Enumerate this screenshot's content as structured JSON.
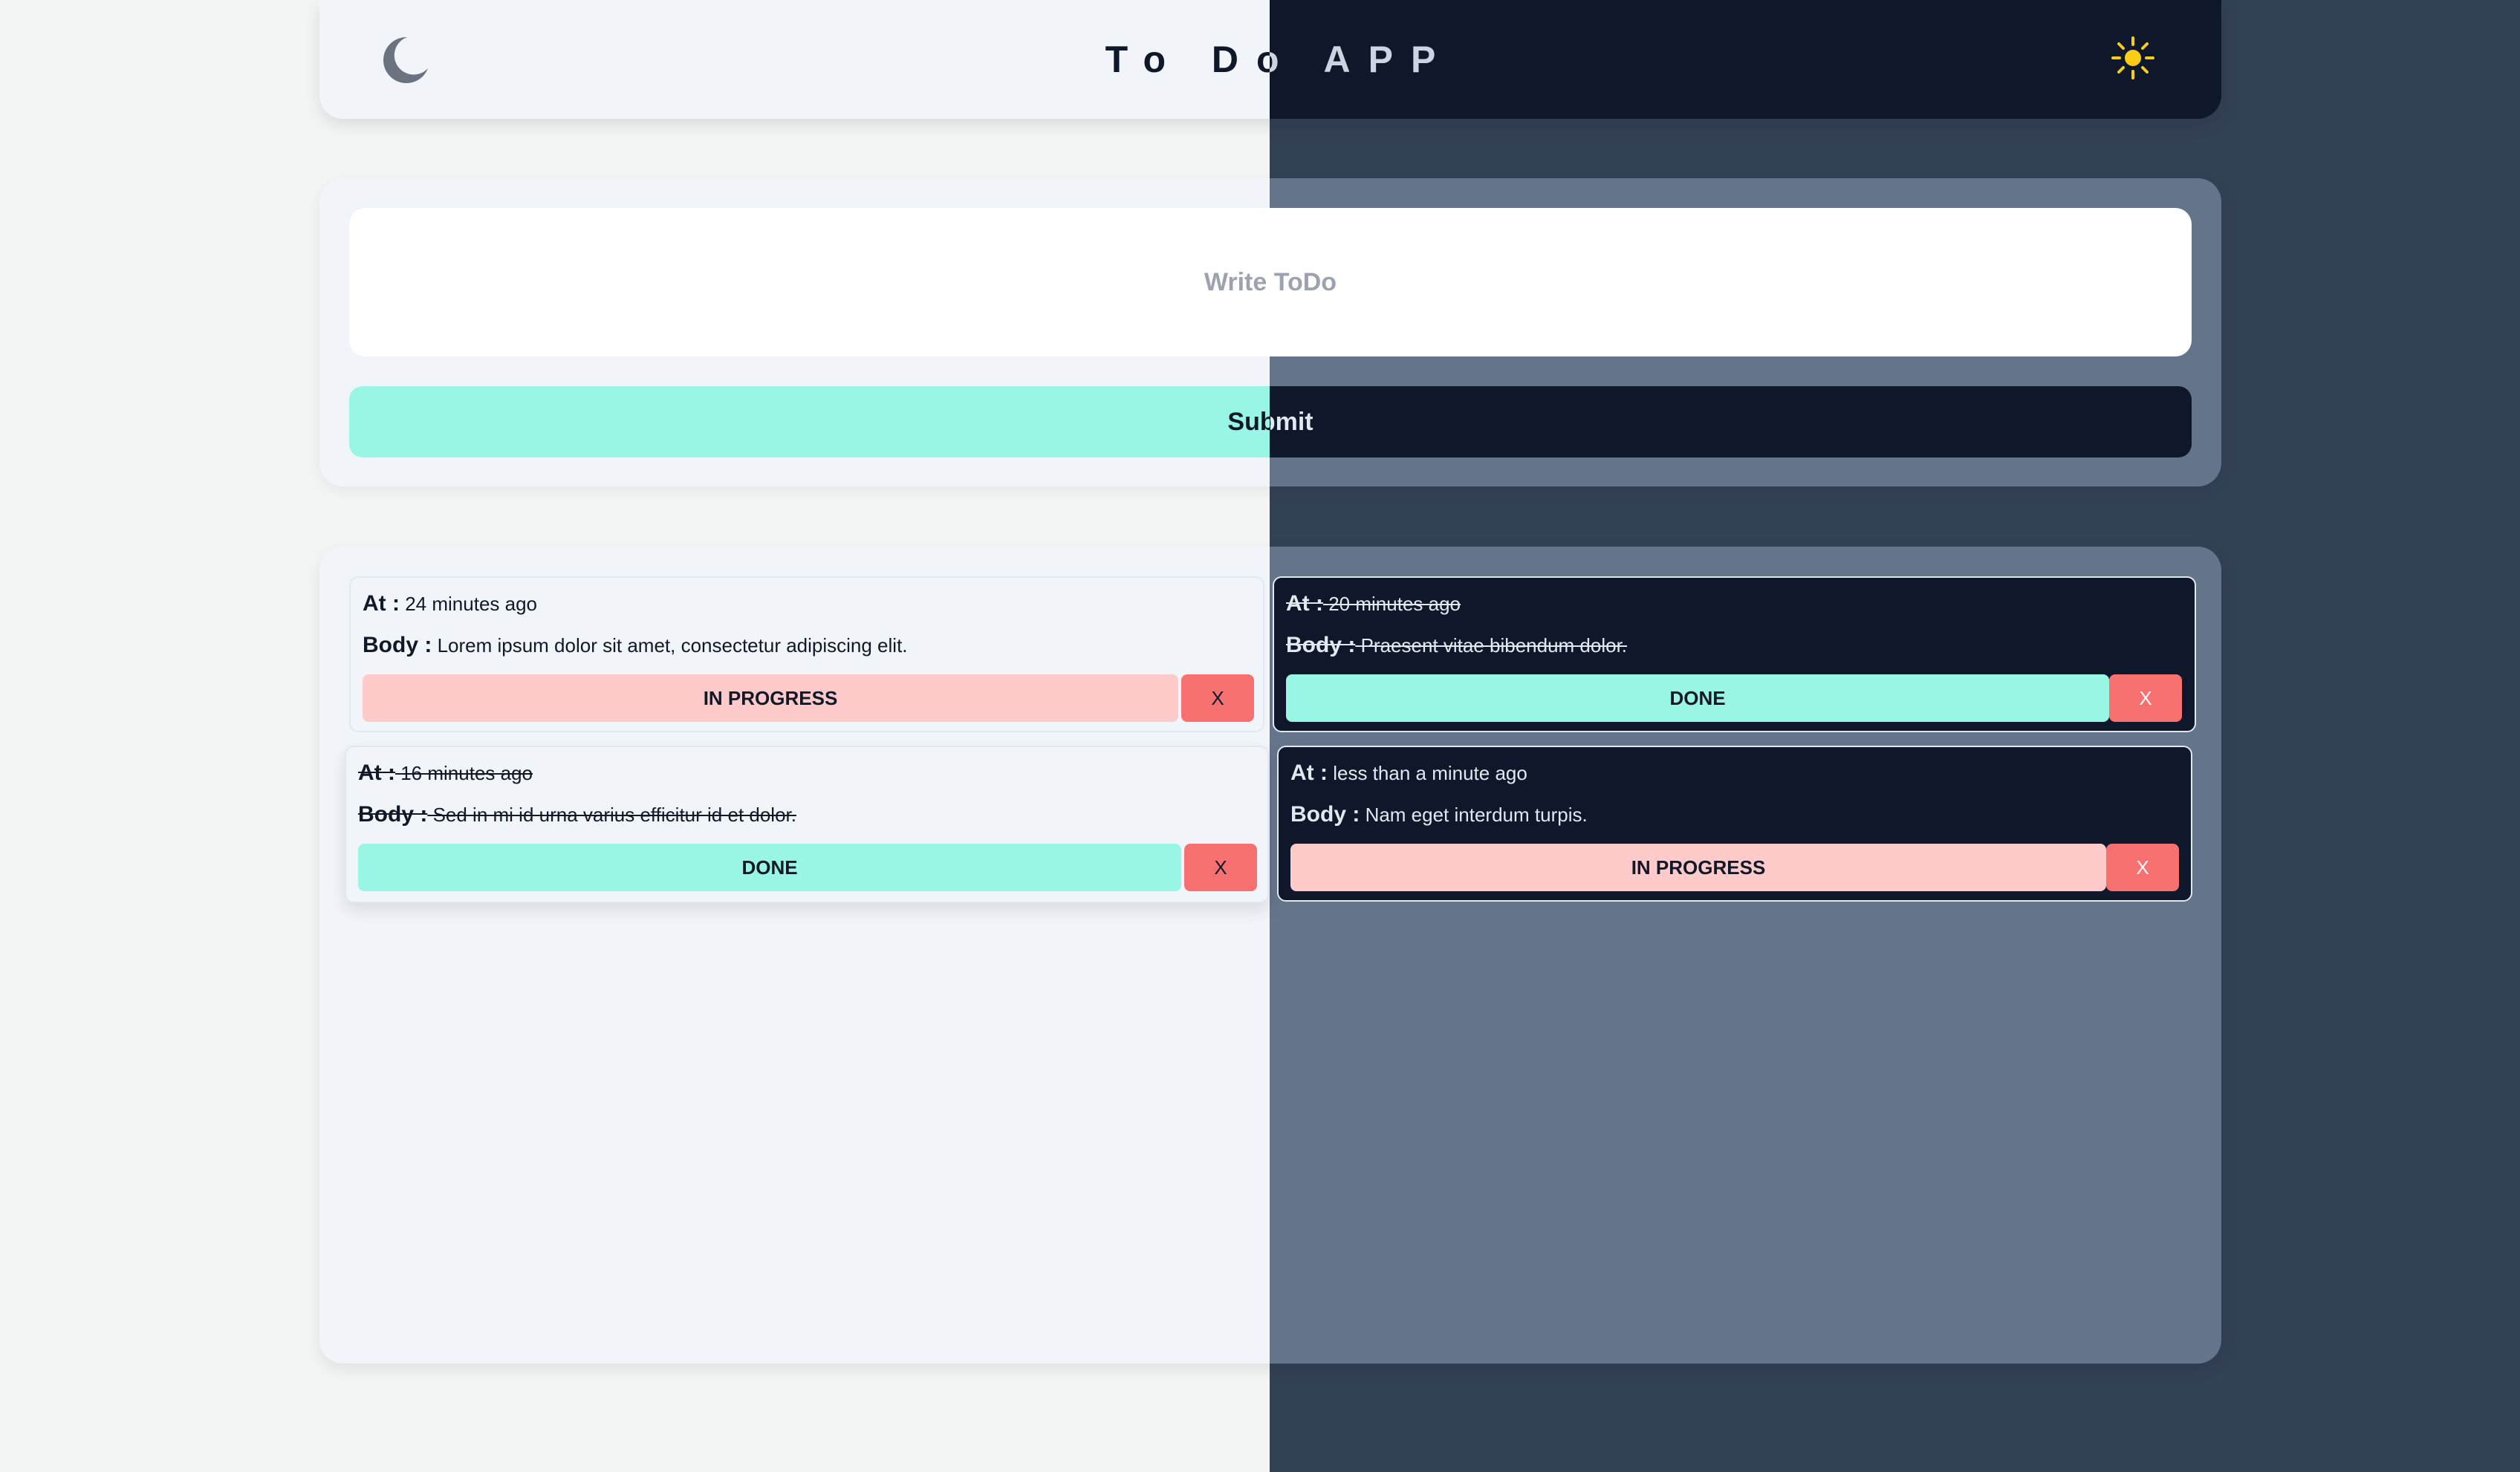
{
  "header": {
    "title": "To Do APP",
    "dark_mode_icon": "moon-icon",
    "light_mode_icon": "sun-icon"
  },
  "form": {
    "input_placeholder": "Write ToDo",
    "input_value": "",
    "submit_label": "Submit"
  },
  "labels": {
    "at": "At :",
    "body": "Body :",
    "delete": "X"
  },
  "todos_light": [
    {
      "at": "24 minutes ago",
      "body": "Lorem ipsum dolor sit amet, consectetur adipiscing elit.",
      "status": "IN PROGRESS"
    },
    {
      "at": "16 minutes ago",
      "body": "Sed in mi id urna varius efficitur id et dolor.",
      "status": "DONE"
    }
  ],
  "todos_dark": [
    {
      "at": "20 minutes ago",
      "body": "Praesent vitae bibendum dolor.",
      "status": "DONE"
    },
    {
      "at": "less than a minute ago",
      "body": "Nam eget interdum turpis.",
      "status": "IN PROGRESS"
    }
  ],
  "colors": {
    "light_bg": "#f1f5f9",
    "dark_bg": "#0f172a",
    "page_dark": "#334155",
    "card_dark": "#64748b",
    "done": "#99f6e4",
    "in_progress": "#fecaca",
    "delete": "#f87171",
    "sun": "#facc15"
  }
}
